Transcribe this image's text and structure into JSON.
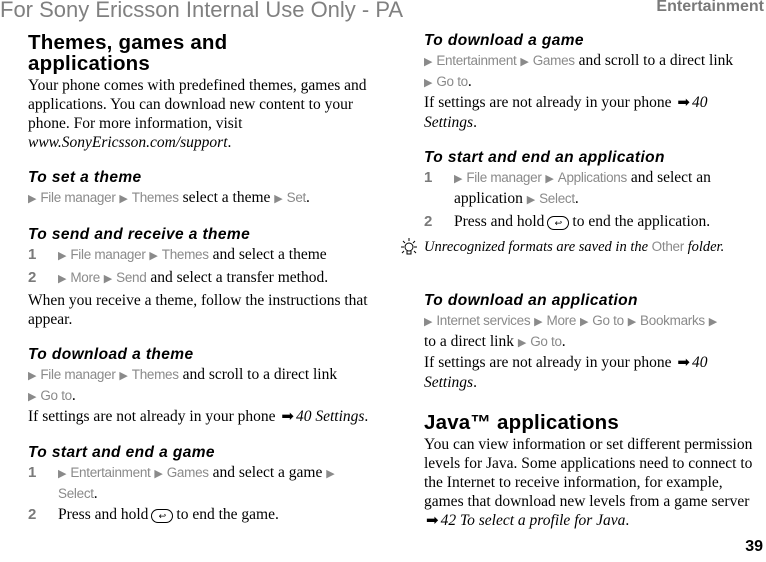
{
  "header": {
    "watermark": "For Sony Ericsson Internal Use Only - PA",
    "section": "Entertainment"
  },
  "footer": {
    "page_number": "39"
  },
  "left": {
    "title_line1": "Themes, games and",
    "title_line2": "applications",
    "intro": "Your phone comes with predefined themes, games and applications. You can download new content to your phone. For more information, visit",
    "intro_link": "www.SonyEricsson.com/support",
    "set_theme": {
      "heading": "To set a theme",
      "menu1": "File manager",
      "menu2": "Themes",
      "text": "select a theme",
      "menu3": "Set"
    },
    "send_theme": {
      "heading": "To send and receive a theme",
      "step1_menu1": "File manager",
      "step1_menu2": "Themes",
      "step1_text": "and select a theme",
      "step2_menu1": "More",
      "step2_menu2": "Send",
      "step2_text": "and select a transfer method.",
      "note": "When you receive a theme, follow the instructions that appear."
    },
    "download_theme": {
      "heading": "To download a theme",
      "menu1": "File manager",
      "menu2": "Themes",
      "text": "and scroll to a direct link",
      "menu3": "Go to",
      "settings_text": "If settings are not already in your phone",
      "ref": "40 Settings"
    },
    "start_game": {
      "heading": "To start and end a game",
      "step1_menu1": "Entertainment",
      "step1_menu2": "Games",
      "step1_text": "and select a game",
      "step1_menu3": "Select",
      "step2_text_a": "Press and hold",
      "step2_text_b": "to end the game."
    }
  },
  "right": {
    "download_game": {
      "heading": "To download a game",
      "menu1": "Entertainment",
      "menu2": "Games",
      "text": "and scroll to a direct link",
      "menu3": "Go to",
      "settings_text": "If settings are not already in your phone",
      "ref": "40 Settings"
    },
    "start_app": {
      "heading": "To start and end an application",
      "step1_menu1": "File manager",
      "step1_menu2": "Applications",
      "step1_text": "and select an application",
      "step1_menu3": "Select",
      "step2_text_a": "Press and hold",
      "step2_text_b": "to end the application."
    },
    "tip": {
      "text_a": "Unrecognized formats are saved in the",
      "menu": "Other",
      "text_b": "folder."
    },
    "download_app": {
      "heading": "To download an application",
      "menu1": "Internet services",
      "menu2": "More",
      "menu3": "Go to",
      "menu4": "Bookmarks",
      "text": "to a direct link",
      "menu5": "Go to",
      "settings_text": "If settings are not already in your phone",
      "ref": "40 Settings"
    },
    "java": {
      "title": "Java™ applications",
      "body": "You can view information or set different permission levels for Java. Some applications need to connect to the Internet to receive information, for example, games that download new levels from a game server",
      "ref": "42 To select a profile for Java"
    }
  },
  "icons": {
    "triangle": "▶",
    "arrow": "➡",
    "back_key": "↩"
  }
}
